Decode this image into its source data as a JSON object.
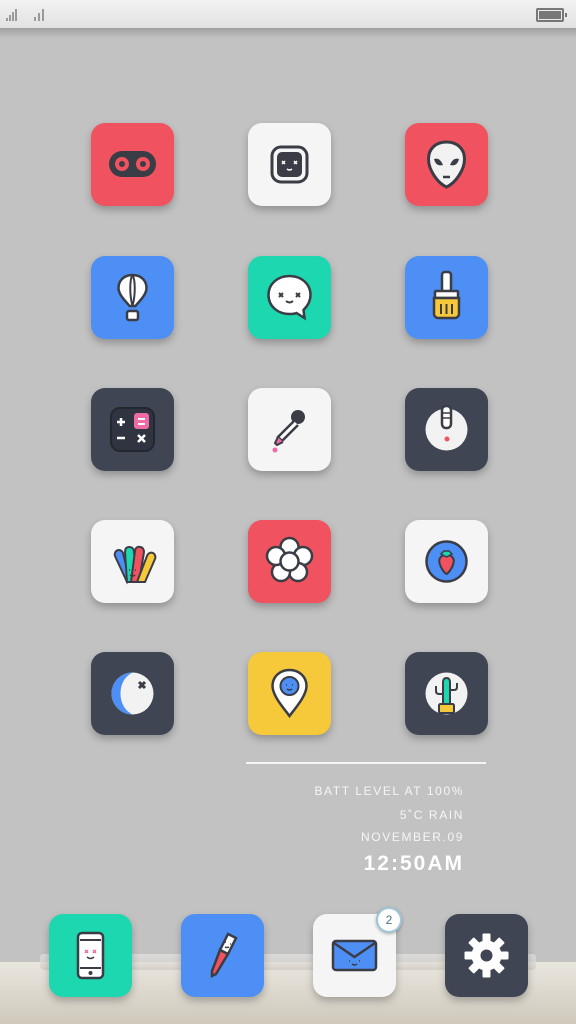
{
  "status_bar": {
    "signal_icon": "signal-bars-icon",
    "wifi_icon": "signal-bars-icon",
    "battery_icon": "battery-icon"
  },
  "home_apps": [
    {
      "icon": "cassette-icon",
      "bg": "#f0525f"
    },
    {
      "icon": "smartwatch-face-icon",
      "bg": "#f5f5f5"
    },
    {
      "icon": "alien-icon",
      "bg": "#f0525f"
    },
    {
      "icon": "hot-air-balloon-icon",
      "bg": "#4d8ff5"
    },
    {
      "icon": "chat-bubble-face-icon",
      "bg": "#1dd7b0"
    },
    {
      "icon": "paint-brush-icon",
      "bg": "#4d8ff5"
    },
    {
      "icon": "calculator-icon",
      "bg": "#3f4552"
    },
    {
      "icon": "dropper-icon",
      "bg": "#f5f5f5"
    },
    {
      "icon": "apple-tv-remote-icon",
      "bg": "#3f4552"
    },
    {
      "icon": "color-swatches-icon",
      "bg": "#f5f5f5"
    },
    {
      "icon": "flower-icon",
      "bg": "#f0525f"
    },
    {
      "icon": "strawberry-icon",
      "bg": "#f5f5f5"
    },
    {
      "icon": "moon-icon",
      "bg": "#3f4552"
    },
    {
      "icon": "map-pin-face-icon",
      "bg": "#f5c93a"
    },
    {
      "icon": "cactus-icon",
      "bg": "#3f4552"
    }
  ],
  "widget": {
    "battery_line": "BATT LEVEL AT 100%",
    "weather_line": "5˚C RAIN",
    "date_line": "NOVEMBER.09",
    "time": "12:50AM"
  },
  "dock": {
    "apps": [
      {
        "icon": "phone-face-icon",
        "bg": "#1dd7b0"
      },
      {
        "icon": "pencil-face-icon",
        "bg": "#4d8ff5"
      },
      {
        "icon": "mail-face-icon",
        "bg": "#f5f5f5"
      },
      {
        "icon": "gear-icon",
        "bg": "#3f4552"
      }
    ],
    "mail_badge": "2"
  }
}
